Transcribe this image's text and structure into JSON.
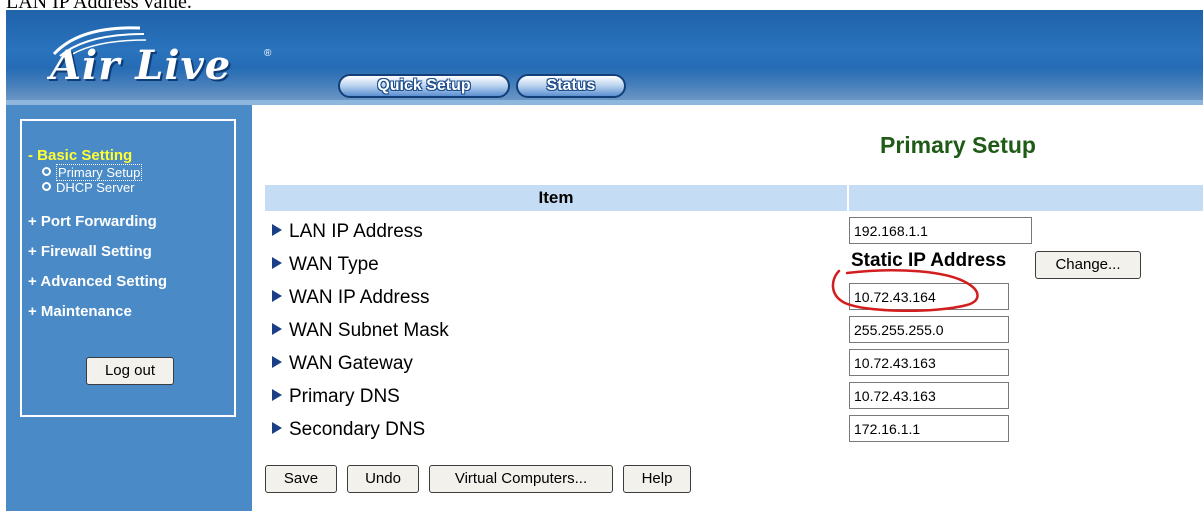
{
  "document": {
    "caption": "LAN IP Address value."
  },
  "header": {
    "logo_text": "Air Live",
    "logo_mark": "®",
    "nav": [
      {
        "label": "Quick Setup"
      },
      {
        "label": "Status"
      }
    ]
  },
  "sidebar": {
    "sections": [
      {
        "label": "- Basic Setting",
        "active": true,
        "items": [
          {
            "label": "Primary Setup",
            "selected": true
          },
          {
            "label": "DHCP Server",
            "selected": false
          }
        ]
      },
      {
        "label": "+ Port Forwarding"
      },
      {
        "label": "+ Firewall Setting"
      },
      {
        "label": "+ Advanced Setting"
      },
      {
        "label": "+ Maintenance"
      }
    ],
    "logout_label": "Log out"
  },
  "main": {
    "title": "Primary Setup",
    "table_header": {
      "item": "Item",
      "value": ""
    },
    "rows": [
      {
        "label": "LAN IP Address",
        "value": "192.168.1.1"
      },
      {
        "label": "WAN Type",
        "value": "Static IP Address",
        "button": "Change..."
      },
      {
        "label": "WAN IP Address",
        "value": "10.72.43.164"
      },
      {
        "label": "WAN Subnet Mask",
        "value": "255.255.255.0"
      },
      {
        "label": "WAN Gateway",
        "value": "10.72.43.163"
      },
      {
        "label": "Primary DNS",
        "value": "10.72.43.163"
      },
      {
        "label": "Secondary DNS",
        "value": "172.16.1.1"
      }
    ],
    "buttons": [
      {
        "label": "Save"
      },
      {
        "label": "Undo"
      },
      {
        "label": "Virtual Computers..."
      },
      {
        "label": "Help"
      }
    ]
  },
  "colors": {
    "header_blue": "#2a73bd",
    "sidebar_blue": "#4a8ac7",
    "active_section": "#ffff33",
    "title_green": "#1f5a17",
    "table_header": "#c4dcf4",
    "annotation_red": "#d21e1e"
  },
  "icons": [
    "row-arrow-icon",
    "sub-item-bullet-icon"
  ]
}
